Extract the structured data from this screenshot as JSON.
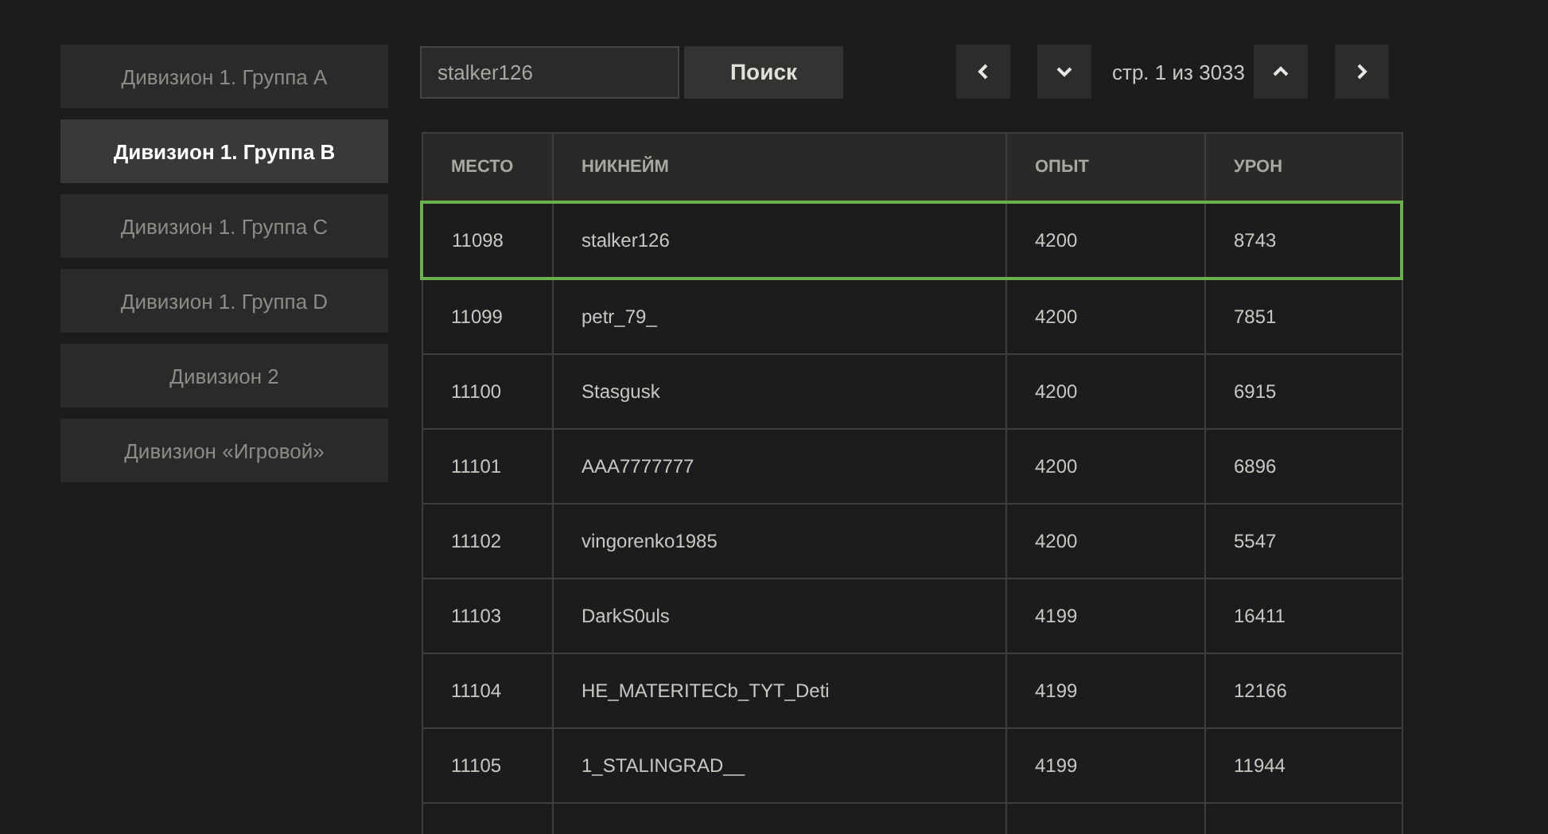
{
  "sidebar": {
    "items": [
      {
        "label": "Дивизион 1. Группа A",
        "selected": false
      },
      {
        "label": "Дивизион 1. Группа B",
        "selected": true
      },
      {
        "label": "Дивизион 1. Группа C",
        "selected": false
      },
      {
        "label": "Дивизион 1. Группа D",
        "selected": false
      },
      {
        "label": "Дивизион 2",
        "selected": false
      },
      {
        "label": "Дивизион «Игровой»",
        "selected": false
      }
    ]
  },
  "search": {
    "value": "stalker126",
    "button": "Поиск"
  },
  "pager": {
    "text": "стр. 1 из 3033"
  },
  "table": {
    "columns": [
      "МЕСТО",
      "НИКНЕЙМ",
      "ОПЫТ",
      "УРОН"
    ],
    "rows": [
      {
        "cells": [
          "11098",
          "stalker126",
          "4200",
          "8743"
        ],
        "selected": true
      },
      {
        "cells": [
          "11099",
          "petr_79_",
          "4200",
          "7851"
        ],
        "selected": false
      },
      {
        "cells": [
          "11100",
          "Stasgusk",
          "4200",
          "6915"
        ],
        "selected": false
      },
      {
        "cells": [
          "11101",
          "AAA7777777",
          "4200",
          "6896"
        ],
        "selected": false
      },
      {
        "cells": [
          "11102",
          "vingorenko1985",
          "4200",
          "5547"
        ],
        "selected": false
      },
      {
        "cells": [
          "11103",
          "DarkS0uls",
          "4199",
          "16411"
        ],
        "selected": false
      },
      {
        "cells": [
          "11104",
          "HE_MATERITECb_TYT_Deti",
          "4199",
          "12166"
        ],
        "selected": false
      },
      {
        "cells": [
          "11105",
          "1_STALINGRAD__",
          "4199",
          "11944"
        ],
        "selected": false
      }
    ]
  }
}
